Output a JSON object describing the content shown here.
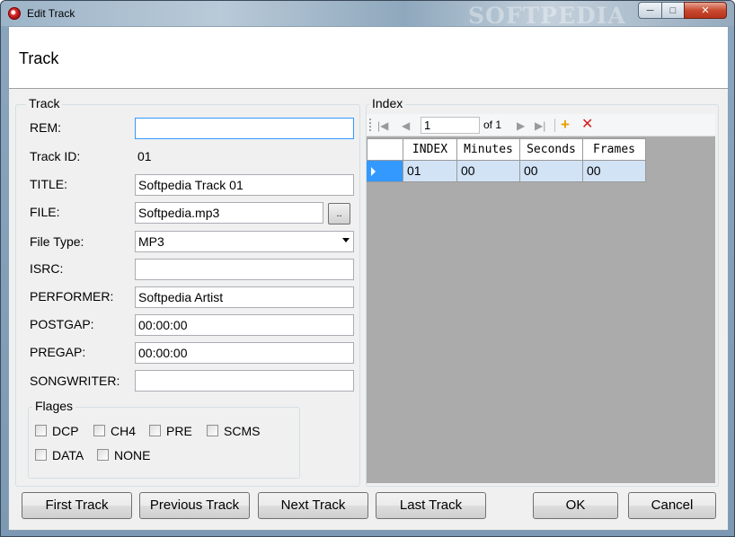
{
  "window": {
    "title": "Edit Track",
    "watermark": "SOFTPEDIA",
    "controls": {
      "minimize": "─",
      "maximize": "□",
      "close": "✕"
    }
  },
  "header": {
    "title": "Track"
  },
  "track_group": {
    "legend": "Track",
    "fields": {
      "rem": {
        "label": "REM:",
        "value": ""
      },
      "track_id": {
        "label": "Track ID:",
        "value": "01"
      },
      "title": {
        "label": "TITLE:",
        "value": "Softpedia Track 01"
      },
      "file": {
        "label": "FILE:",
        "value": "Softpedia.mp3",
        "browse": ".."
      },
      "file_type": {
        "label": "File Type:",
        "value": "MP3"
      },
      "isrc": {
        "label": "ISRC:",
        "value": ""
      },
      "performer": {
        "label": "PERFORMER:",
        "value": "Softpedia Artist"
      },
      "postgap": {
        "label": "POSTGAP:",
        "value": "00:00:00"
      },
      "pregap": {
        "label": "PREGAP:",
        "value": "00:00:00"
      },
      "songwriter": {
        "label": "SONGWRITER:",
        "value": ""
      }
    },
    "flags": {
      "legend": "Flages",
      "items": [
        "DCP",
        "CH4",
        "PRE",
        "SCMS",
        "DATA",
        "NONE"
      ]
    }
  },
  "index_group": {
    "legend": "Index",
    "nav": {
      "position": "1",
      "of": "of 1"
    },
    "columns": [
      "INDEX",
      "Minutes",
      "Seconds",
      "Frames"
    ],
    "rows": [
      [
        "01",
        "00",
        "00",
        "00"
      ]
    ]
  },
  "buttons": {
    "first": "First Track",
    "previous": "Previous Track",
    "next": "Next Track",
    "last": "Last Track",
    "ok": "OK",
    "cancel": "Cancel"
  },
  "colors": {
    "selection": "#d3e3f6",
    "grid_bg": "#ababab",
    "title_bar": "#9db4c8"
  }
}
